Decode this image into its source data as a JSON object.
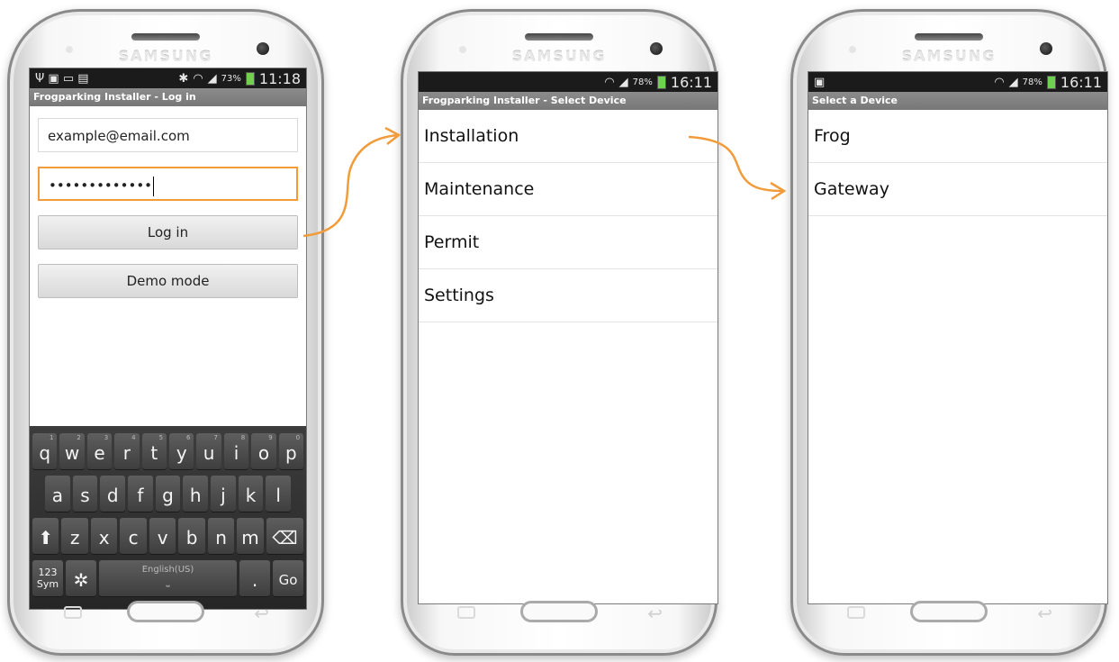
{
  "brand": "SAMSUNG",
  "accent_color": "#f29b3a",
  "phone1": {
    "status": {
      "battery": "73%",
      "time": "11:18",
      "left_icons": [
        "usb-icon",
        "image-icon",
        "keyboard-icon",
        "calendar-icon"
      ]
    },
    "title": "Frogparking Installer - Log in",
    "email_value": "example@email.com",
    "password_value": "•••••••••••••",
    "login_button": "Log in",
    "demo_button": "Demo mode",
    "keyboard": {
      "row1": [
        "q",
        "w",
        "e",
        "r",
        "t",
        "y",
        "u",
        "i",
        "o",
        "p"
      ],
      "row1_digits": [
        "1",
        "2",
        "3",
        "4",
        "5",
        "6",
        "7",
        "8",
        "9",
        "0"
      ],
      "row2": [
        "a",
        "s",
        "d",
        "f",
        "g",
        "h",
        "j",
        "k",
        "l"
      ],
      "row3": [
        "z",
        "x",
        "c",
        "v",
        "b",
        "n",
        "m"
      ],
      "sym_key": "123\nSym",
      "space_label": "English(US)",
      "period_key": ".",
      "go_key": "Go"
    }
  },
  "phone2": {
    "status": {
      "battery": "78%",
      "time": "16:11"
    },
    "title": "Frogparking Installer - Select Device",
    "menu_items": [
      "Installation",
      "Maintenance",
      "Permit",
      "Settings"
    ]
  },
  "phone3": {
    "status": {
      "battery": "78%",
      "time": "16:11"
    },
    "title": "Select a Device",
    "devices": [
      "Frog",
      "Gateway"
    ]
  }
}
